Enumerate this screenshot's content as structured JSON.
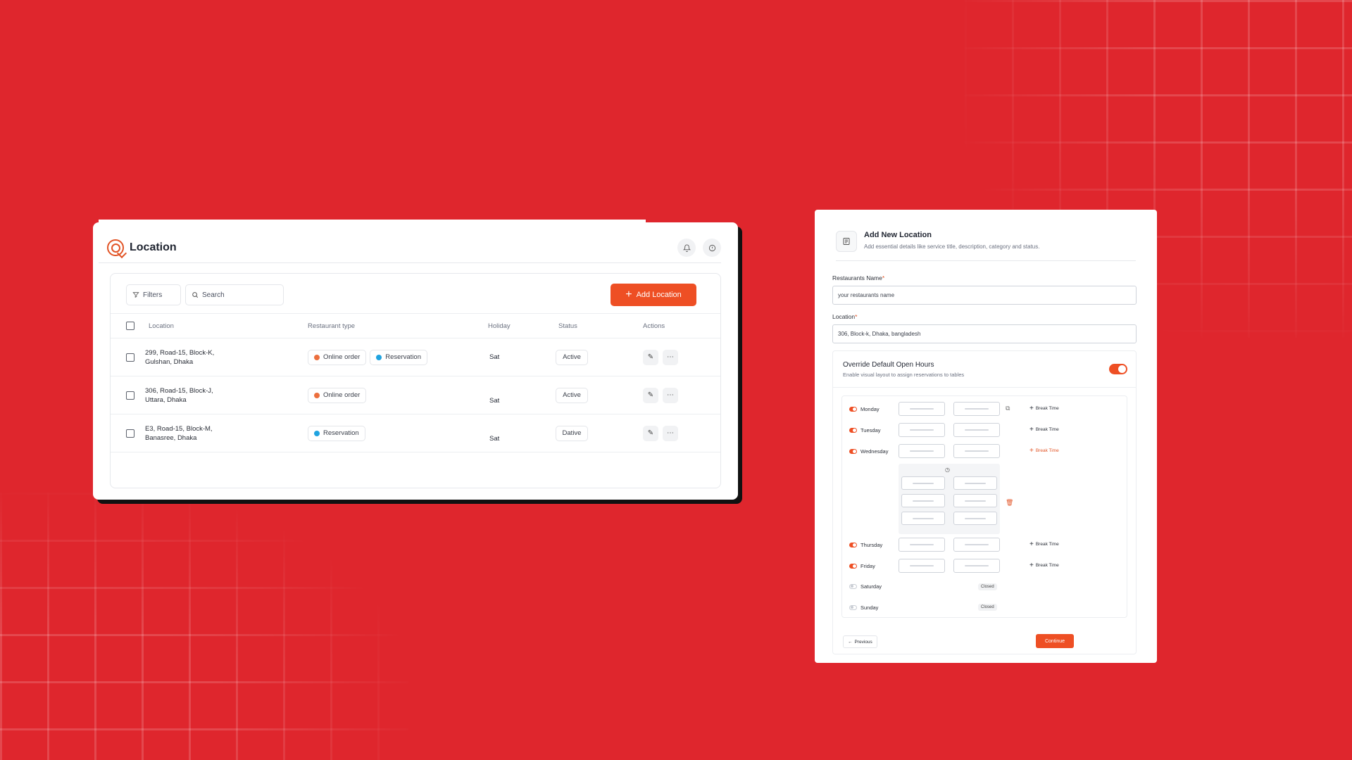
{
  "location_page": {
    "title": "Location",
    "toolbar": {
      "filters_label": "Filters",
      "search_placeholder": "Search",
      "add_label": "Add Location"
    },
    "columns": [
      "Location",
      "Restaurant type",
      "Holiday",
      "Status",
      "Actions"
    ],
    "rows": [
      {
        "address_line1": "299, Road-15, Block-K,",
        "address_line2": "Gulshan, Dhaka",
        "types": [
          "Online order",
          "Reservation"
        ],
        "holiday": "Sat",
        "status": "Active"
      },
      {
        "address_line1": "306, Road-15, Block-J,",
        "address_line2": "Uttara, Dhaka",
        "types": [
          "Online order"
        ],
        "holiday": "Sat",
        "status": "Active"
      },
      {
        "address_line1": "E3, Road-15, Block-M,",
        "address_line2": "Banasree, Dhaka",
        "types": [
          "Reservation"
        ],
        "holiday": "Sat",
        "status": "Dative"
      }
    ],
    "colors": {
      "online_order": "#ec6f3d",
      "reservation": "#1fa3e0",
      "accent": "#ee4f24"
    }
  },
  "add_form": {
    "title": "Add New Location",
    "subtitle": "Add essential details like service title, description, category and status.",
    "name_label": "Restaurants Name",
    "name_value": "your restaurants name",
    "location_label": "Location",
    "location_value": "306, Block-k, Dhaka, bangladesh",
    "required_mark": "*",
    "override_title": "Override Default Open Hours",
    "override_subtitle": "Enable visual layout to assign reservations to tables",
    "override_enabled": true,
    "days": [
      {
        "name": "Monday",
        "open": true
      },
      {
        "name": "Tuesday",
        "open": true
      },
      {
        "name": "Wednesday",
        "open": true
      },
      {
        "name": "Thursday",
        "open": true
      },
      {
        "name": "Friday",
        "open": true
      },
      {
        "name": "Saturday",
        "open": false
      },
      {
        "name": "Sunday",
        "open": false
      }
    ],
    "break_time_label": "Break Time",
    "closed_label": "Closed",
    "previous_label": "Previous",
    "continue_label": "Continue"
  }
}
